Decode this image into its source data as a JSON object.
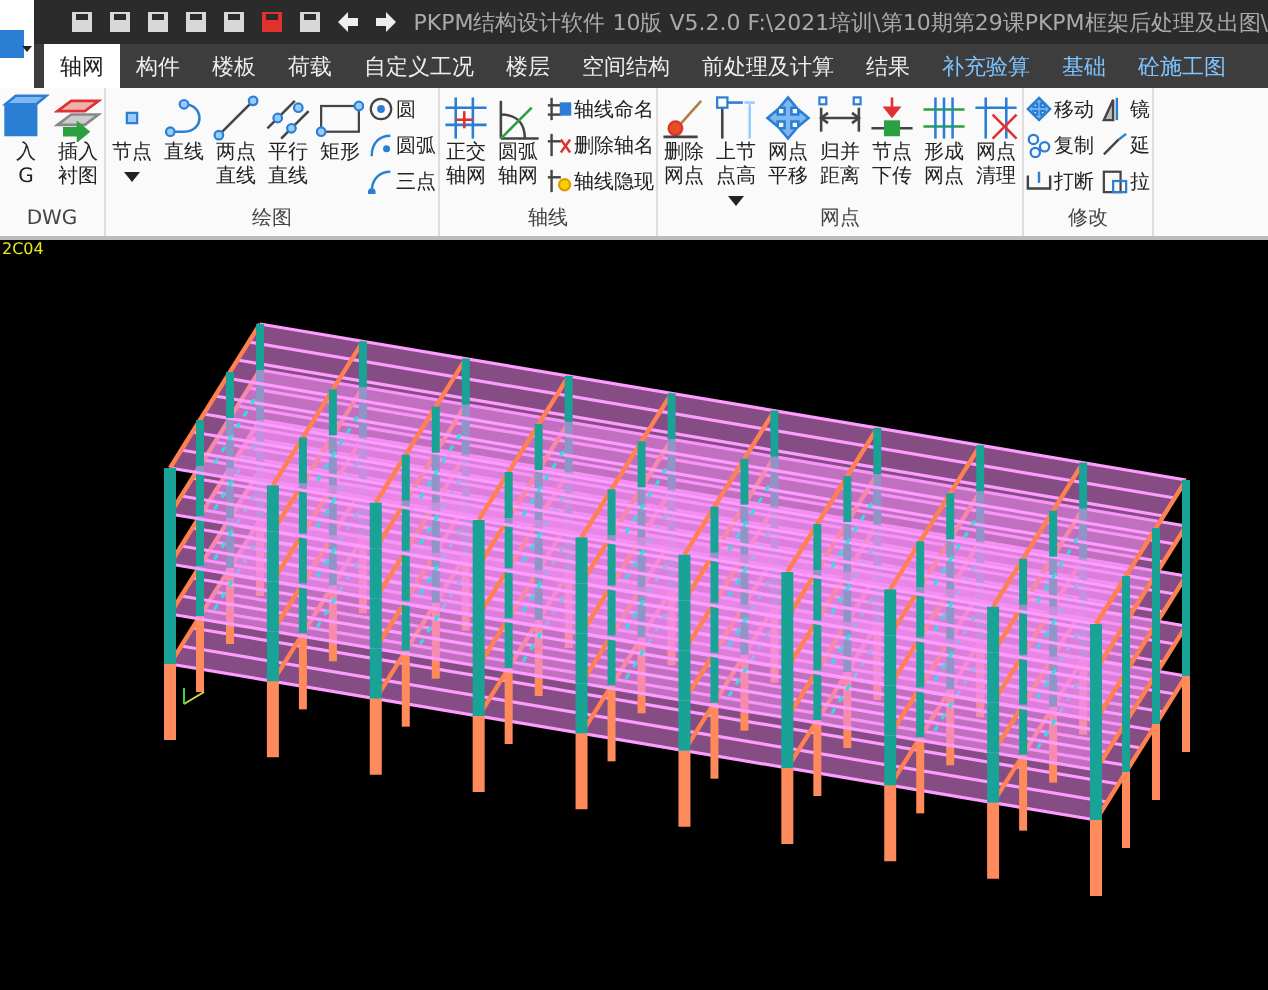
{
  "title_bar": {
    "title": "PKPM结构设计软件 10版 V5.2.0 F:\\2021培训\\第10期第29课PKPM框架后处理及出图\\"
  },
  "tabs": [
    {
      "label": "轴网",
      "selected": true,
      "kind": "module"
    },
    {
      "label": "构件",
      "selected": false,
      "kind": "module"
    },
    {
      "label": "楼板",
      "selected": false,
      "kind": "module"
    },
    {
      "label": "荷载",
      "selected": false,
      "kind": "module"
    },
    {
      "label": "自定义工况",
      "selected": false,
      "kind": "module"
    },
    {
      "label": "楼层",
      "selected": false,
      "kind": "module"
    },
    {
      "label": "空间结构",
      "selected": false,
      "kind": "module"
    },
    {
      "label": "前处理及计算",
      "selected": false,
      "kind": "module"
    },
    {
      "label": "结果",
      "selected": false,
      "kind": "module"
    },
    {
      "label": "补充验算",
      "selected": false,
      "kind": "addon"
    },
    {
      "label": "基础",
      "selected": false,
      "kind": "addon"
    },
    {
      "label": "砼施工图",
      "selected": false,
      "kind": "addon"
    }
  ],
  "ribbon": {
    "groups": [
      {
        "title": "DWG",
        "buttons": [
          {
            "kind": "large",
            "lines": [
              "入",
              "G"
            ]
          },
          {
            "kind": "large",
            "lines": [
              "插入",
              "衬图"
            ]
          }
        ]
      },
      {
        "title": "绘图",
        "buttons": [
          {
            "kind": "large",
            "lines": [
              "节点"
            ],
            "dropdown": true
          },
          {
            "kind": "large",
            "lines": [
              "直线"
            ]
          },
          {
            "kind": "large",
            "lines": [
              "两点",
              "直线"
            ]
          },
          {
            "kind": "large",
            "lines": [
              "平行",
              "直线"
            ]
          },
          {
            "kind": "large",
            "lines": [
              "矩形"
            ]
          },
          {
            "kind": "small",
            "lines": [
              "圆"
            ]
          },
          {
            "kind": "small",
            "lines": [
              "圆弧"
            ]
          },
          {
            "kind": "small",
            "lines": [
              "三点"
            ]
          }
        ]
      },
      {
        "title": "轴线",
        "buttons": [
          {
            "kind": "large",
            "lines": [
              "正交",
              "轴网"
            ]
          },
          {
            "kind": "large",
            "lines": [
              "圆弧",
              "轴网"
            ]
          },
          {
            "kind": "small",
            "lines": [
              "轴线命名"
            ]
          },
          {
            "kind": "small",
            "lines": [
              "删除轴名"
            ]
          },
          {
            "kind": "small",
            "lines": [
              "轴线隐现"
            ]
          }
        ]
      },
      {
        "title": "网点",
        "buttons": [
          {
            "kind": "large",
            "lines": [
              "删除",
              "网点"
            ]
          },
          {
            "kind": "large",
            "lines": [
              "上节",
              "点高"
            ],
            "dropdown": true
          },
          {
            "kind": "large",
            "lines": [
              "网点",
              "平移"
            ]
          },
          {
            "kind": "large",
            "lines": [
              "归并",
              "距离"
            ]
          },
          {
            "kind": "large",
            "lines": [
              "节点",
              "下传"
            ]
          },
          {
            "kind": "large",
            "lines": [
              "形成",
              "网点"
            ]
          },
          {
            "kind": "large",
            "lines": [
              "网点",
              "清理"
            ]
          }
        ]
      },
      {
        "title": "修改",
        "buttons": [
          {
            "kind": "small",
            "lines": [
              "移动"
            ]
          },
          {
            "kind": "small",
            "lines": [
              "复制"
            ]
          },
          {
            "kind": "small",
            "lines": [
              "打断"
            ]
          },
          {
            "kind": "small",
            "lines": [
              "镜"
            ]
          },
          {
            "kind": "small",
            "lines": [
              "延"
            ]
          },
          {
            "kind": "small",
            "lines": [
              "拉"
            ]
          }
        ]
      }
    ]
  },
  "canvas": {
    "coordinate_text": "2C04"
  }
}
